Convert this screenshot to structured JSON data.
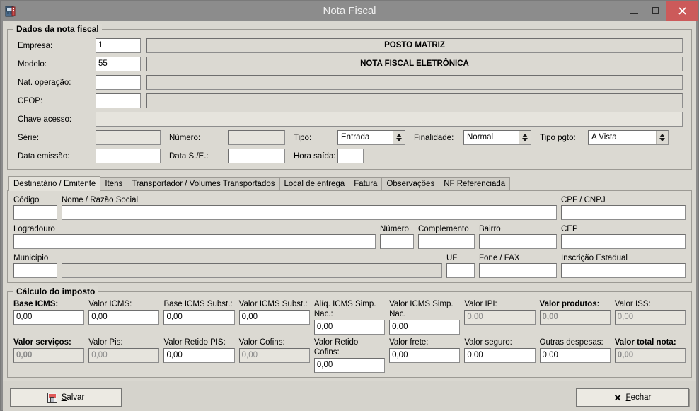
{
  "window": {
    "title": "Nota Fiscal",
    "icon": "nota-fiscal-app-icon",
    "minimize": "–",
    "maximize": "▢",
    "close": "✕"
  },
  "dados": {
    "legend": "Dados da nota fiscal",
    "empresa": {
      "label": "Empresa:",
      "code": "1",
      "name": "POSTO MATRIZ"
    },
    "modelo": {
      "label": "Modelo:",
      "code": "55",
      "name": "NOTA FISCAL ELETRÔNICA"
    },
    "nat_operacao": {
      "label": "Nat. operação:",
      "code": "",
      "name": ""
    },
    "cfop": {
      "label": "CFOP:",
      "code": "",
      "name": ""
    },
    "chave_acesso": {
      "label": "Chave acesso:",
      "value": ""
    },
    "serie": {
      "label": "Série:",
      "value": ""
    },
    "numero": {
      "label": "Número:",
      "value": ""
    },
    "tipo": {
      "label": "Tipo:",
      "value": "Entrada"
    },
    "finalidade": {
      "label": "Finalidade:",
      "value": "Normal"
    },
    "tipo_pgto": {
      "label": "Tipo pgto:",
      "value": "A Vista"
    },
    "data_emissao": {
      "label": "Data emissão:",
      "value": ""
    },
    "data_se": {
      "label": "Data S./E.:",
      "value": ""
    },
    "hora_saida": {
      "label": "Hora saída:",
      "value": ""
    }
  },
  "tabs": [
    {
      "label": "Destinatário / Emitente",
      "active": true
    },
    {
      "label": "Itens",
      "active": false
    },
    {
      "label": "Transportador / Volumes Transportados",
      "active": false
    },
    {
      "label": "Local de entrega",
      "active": false
    },
    {
      "label": "Fatura",
      "active": false
    },
    {
      "label": "Observações",
      "active": false
    },
    {
      "label": "NF Referenciada",
      "active": false
    }
  ],
  "destinatario": {
    "codigo": {
      "label": "Código",
      "value": ""
    },
    "nome": {
      "label": "Nome / Razão Social",
      "value": ""
    },
    "cpf_cnpj": {
      "label": "CPF / CNPJ",
      "value": ""
    },
    "logradouro": {
      "label": "Logradouro",
      "value": ""
    },
    "numero": {
      "label": "Número",
      "value": ""
    },
    "complemento": {
      "label": "Complemento",
      "value": ""
    },
    "bairro": {
      "label": "Bairro",
      "value": ""
    },
    "cep": {
      "label": "CEP",
      "value": ""
    },
    "municipio": {
      "label": "Município",
      "code": "",
      "name": ""
    },
    "uf": {
      "label": "UF",
      "value": ""
    },
    "fone_fax": {
      "label": "Fone / FAX",
      "value": ""
    },
    "inscricao_estadual": {
      "label": "Inscrição Estadual",
      "value": ""
    }
  },
  "imposto": {
    "legend": "Cálculo do imposto",
    "row1": [
      {
        "label": "Base ICMS:",
        "value": "0,00",
        "bold": false,
        "state": "edit"
      },
      {
        "label": "Valor ICMS:",
        "value": "0,00",
        "bold": false,
        "state": "edit"
      },
      {
        "label": "Base ICMS Subst.:",
        "value": "0,00",
        "bold": false,
        "state": "edit"
      },
      {
        "label": "Valor ICMS Subst.:",
        "value": "0,00",
        "bold": false,
        "state": "edit"
      },
      {
        "label": "Alíq. ICMS Simp. Nac.:",
        "value": "0,00",
        "bold": false,
        "state": "edit"
      },
      {
        "label": "Valor ICMS Simp. Nac.",
        "value": "0,00",
        "bold": false,
        "state": "edit"
      },
      {
        "label": "Valor IPI:",
        "value": "0,00",
        "bold": false,
        "state": "readonly"
      },
      {
        "label": "Valor produtos:",
        "value": "0,00",
        "bold": true,
        "state": "readonly"
      },
      {
        "label": "Valor ISS:",
        "value": "0,00",
        "bold": false,
        "state": "readonly"
      }
    ],
    "row2": [
      {
        "label": "Valor serviços:",
        "value": "0,00",
        "bold": true,
        "state": "readonly"
      },
      {
        "label": "Valor Pis:",
        "value": "0,00",
        "bold": false,
        "state": "readonly"
      },
      {
        "label": "Valor Retido PIS:",
        "value": "0,00",
        "bold": false,
        "state": "edit"
      },
      {
        "label": "Valor Cofins:",
        "value": "0,00",
        "bold": false,
        "state": "readonly"
      },
      {
        "label": "Valor Retido Cofins:",
        "value": "0,00",
        "bold": false,
        "state": "edit"
      },
      {
        "label": "Valor frete:",
        "value": "0,00",
        "bold": false,
        "state": "edit"
      },
      {
        "label": "Valor seguro:",
        "value": "0,00",
        "bold": false,
        "state": "edit"
      },
      {
        "label": "Outras despesas:",
        "value": "0,00",
        "bold": false,
        "state": "edit"
      },
      {
        "label": "Valor total nota:",
        "value": "0,00",
        "bold": true,
        "state": "readonly"
      }
    ]
  },
  "footer": {
    "save": {
      "label": "Salvar",
      "accel": "S",
      "icon": "floppy-disk-icon"
    },
    "close": {
      "label": "Fechar",
      "accel": "F",
      "icon": "x-icon"
    }
  },
  "colors": {
    "titlebar": "#8c8c8c",
    "close_button": "#cc5a5a",
    "client": "#d9d7d0",
    "field_border": "#6e6e6e",
    "readonly_text": "#8a8a8a"
  }
}
